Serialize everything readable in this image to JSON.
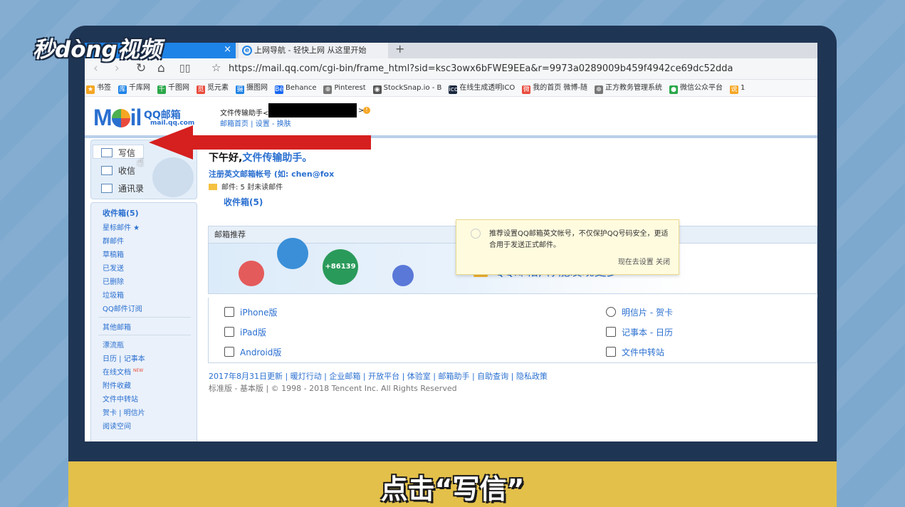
{
  "watermark": "秒dòng视频",
  "caption": "点击“写信”",
  "browser": {
    "tab_active_close": "×",
    "tab2_label": "上网导航 - 轻快上网 从这里开始",
    "tab2_icon": "e",
    "new_tab": "+",
    "url": "https://mail.qq.com/cgi-bin/frame_html?sid=ksc3owx6bFWE9EEa&r=9973a0289009b459f4942ce69dc52dda",
    "bookmarks": [
      {
        "label": "书签",
        "color": "#f5a623",
        "icon": "★"
      },
      {
        "label": "千库网",
        "color": "#1e83e6",
        "icon": "库"
      },
      {
        "label": "千图网",
        "color": "#2aa84a",
        "icon": "千"
      },
      {
        "label": "觅元素",
        "color": "#e94b3c",
        "icon": "觅"
      },
      {
        "label": "摄图网",
        "color": "#1e83e6",
        "icon": "摄"
      },
      {
        "label": "Behance",
        "color": "#1767f2",
        "icon": "Bē"
      },
      {
        "label": "Pinterest",
        "color": "#777",
        "icon": "⊕"
      },
      {
        "label": "StockSnap.io - B",
        "color": "#555",
        "icon": "◉"
      },
      {
        "label": "在线生成透明ICO",
        "color": "#1a2940",
        "icon": "ico"
      },
      {
        "label": "我的首页 微博-随",
        "color": "#e94b3c",
        "icon": "微"
      },
      {
        "label": "正方教务管理系统",
        "color": "#777",
        "icon": "⊕"
      },
      {
        "label": "微信公众平台",
        "color": "#2aa84a",
        "icon": "●"
      },
      {
        "label": "1",
        "color": "#f5a623",
        "icon": "说"
      }
    ]
  },
  "mail": {
    "logo_text": "M  il",
    "logo_qq": "QQ邮箱",
    "logo_url": "mail.qq.com",
    "account_name": "文件传输助手<",
    "account_suffix": ">",
    "warn": "!",
    "header_links": "邮箱首页 | 设置 - 换肤",
    "sidebar": {
      "write": "写信",
      "receive": "收信",
      "contacts": "通讯录",
      "items": [
        "收件箱(5)",
        "星标邮件 ★",
        "群邮件",
        "草稿箱",
        "已发送",
        "已删除",
        "垃圾箱",
        "QQ邮件订阅",
        "其他邮箱",
        "漂流瓶",
        "日历 | 记事本",
        "在线文档",
        "附件收藏",
        "文件中转站",
        "贺卡 | 明信片",
        "阅读空间"
      ],
      "new_badge": "NEW"
    },
    "greeting_prefix": "下午好,",
    "greeting_name": "文件传输助手。",
    "register": "注册英文邮箱帐号 (如: chen@fox",
    "mail_count": "邮件: 5 封未读邮件",
    "inbox_link": "收件箱(5)",
    "tip": {
      "text": "推荐设置QQ邮箱英文帐号，不仅保护QQ号码安全，更适合用于发送正式邮件。",
      "actions": "现在去设置   关闭"
    },
    "recommend_title": "邮箱推荐",
    "banner_text": "QQ邮箱, 你能发现更多",
    "banner_phone": "+86139",
    "apps_left": [
      "iPhone版",
      "iPad版",
      "Android版"
    ],
    "apps_right": [
      "明信片 - 贺卡",
      "记事本 - 日历",
      "文件中转站"
    ],
    "footer_line1": "2017年8月31日更新 | 暖灯行动 | 企业邮箱 | 开放平台 | 体验室 | 邮箱助手 | 自助查询 | 隐私政策",
    "footer_line2": "标准版 - 基本版 | © 1998 - 2018 Tencent Inc. All Rights Reserved"
  }
}
